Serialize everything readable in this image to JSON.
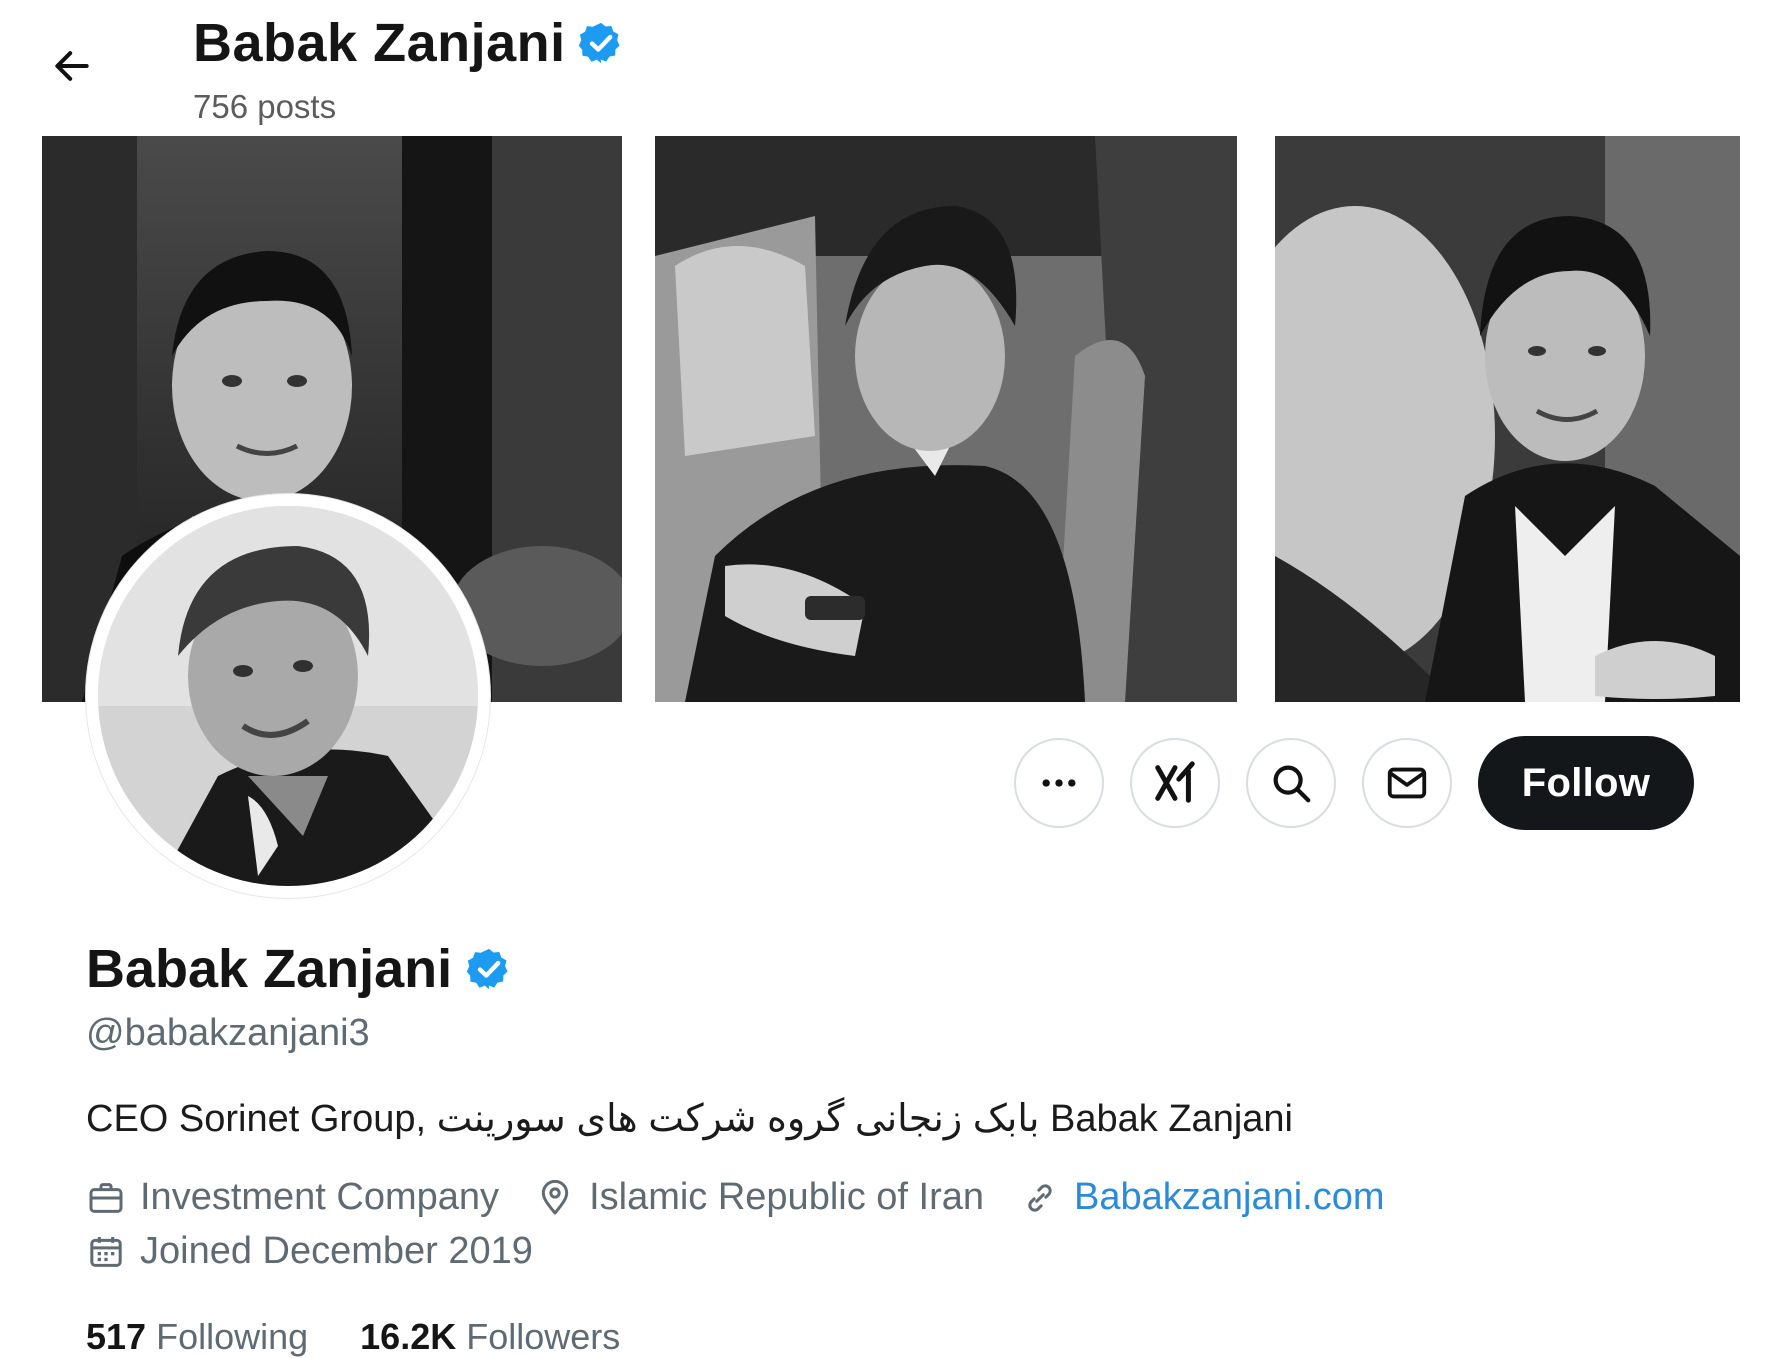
{
  "header": {
    "name": "Babak Zanjani",
    "posts": "756 posts",
    "back_icon": "arrow-left-icon",
    "verified_icon": "verified-badge-icon"
  },
  "banner": {
    "photos": [
      "banner-photo-left",
      "banner-photo-center",
      "banner-photo-right"
    ]
  },
  "actions": {
    "more_icon": "more-dots-icon",
    "grok_icon": "grok-icon",
    "search_icon": "search-icon",
    "message_icon": "envelope-icon",
    "follow_label": "Follow"
  },
  "profile": {
    "name": "Babak Zanjani",
    "handle": "@babakzanjani3",
    "bio": "CEO Sorinet Group, بابک زنجانی گروه شرکت های سورینت Babak Zanjani",
    "category": "Investment Company",
    "location": "Islamic Republic of Iran",
    "website": "Babakzanjani.com",
    "joined": "Joined December 2019"
  },
  "stats": {
    "following_count": "517",
    "following_label": "Following",
    "followers_count": "16.2K",
    "followers_label": "Followers"
  },
  "colors": {
    "verified": "#1d9bf0",
    "link": "#2b8ad9",
    "follow_bg": "#14171a",
    "muted_text": "#5f6a73"
  }
}
